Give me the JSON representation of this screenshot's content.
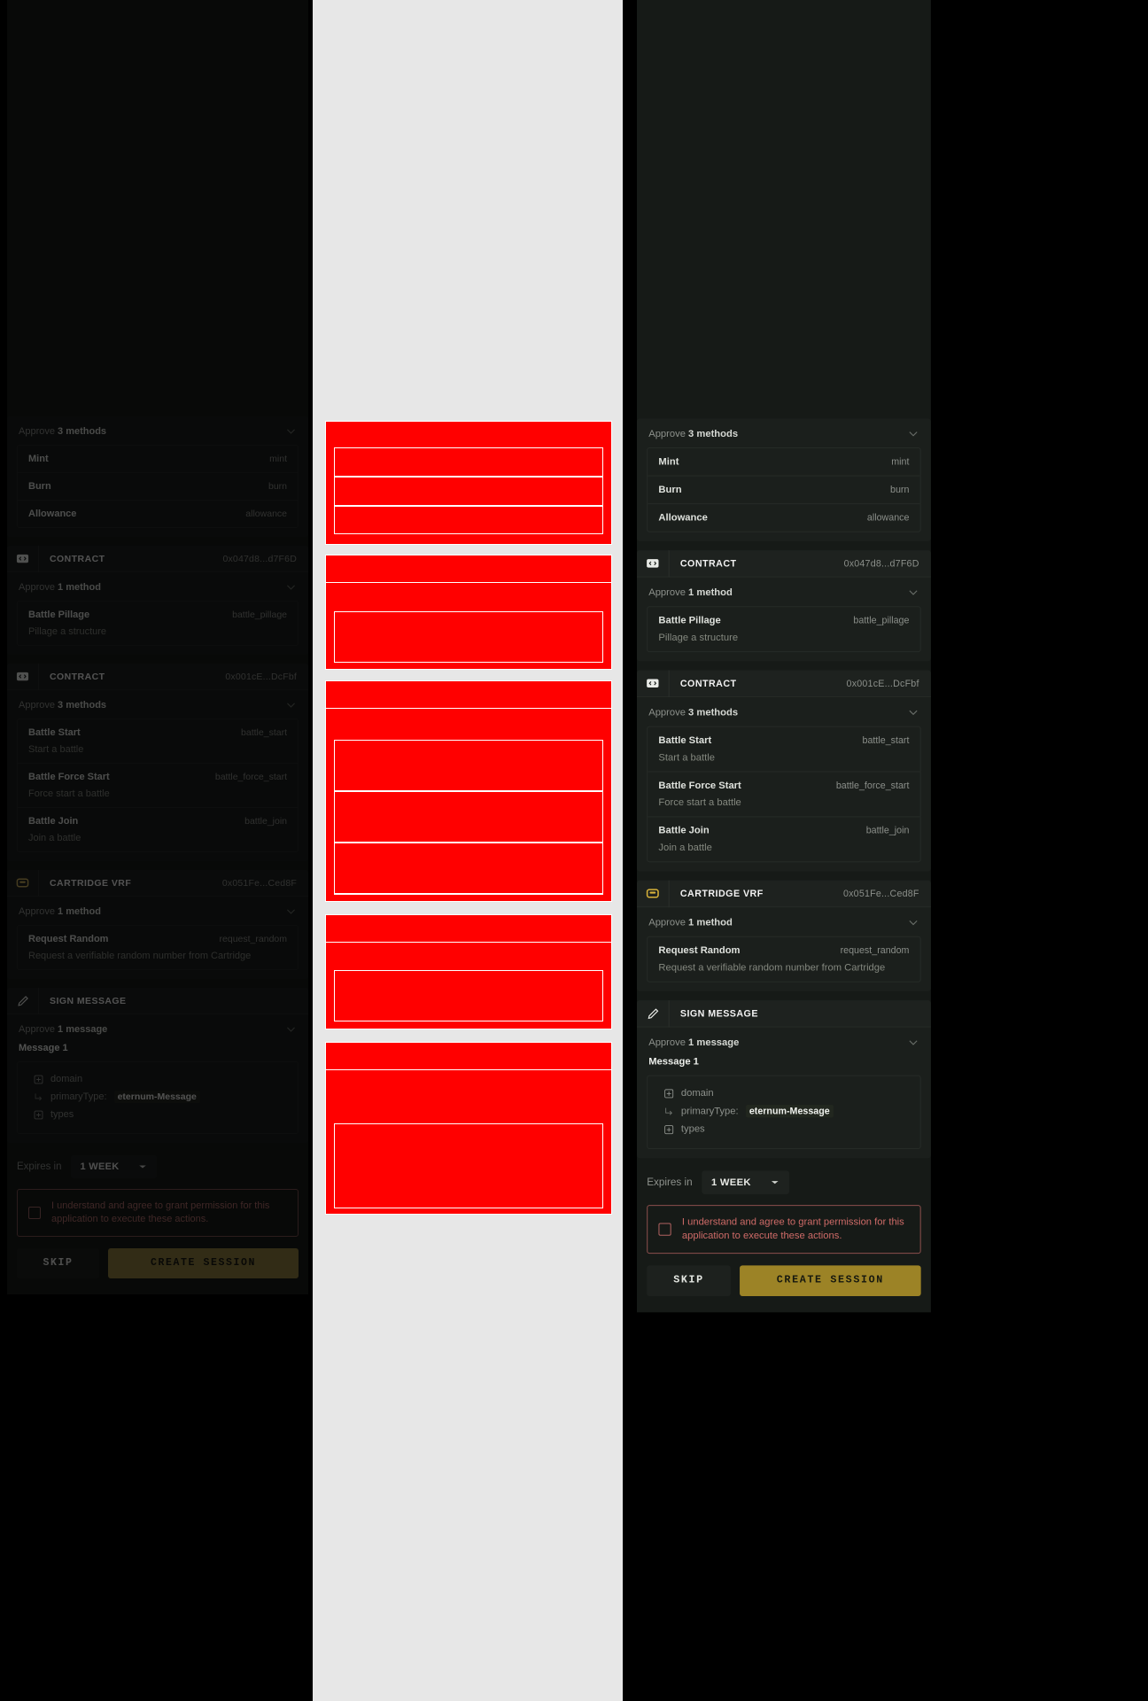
{
  "app": {
    "title": "Create Session",
    "theme_accent": "#9c8326",
    "background": "#000000",
    "panel_background": "#161a17",
    "card_background": "#1b1f1c",
    "mask_fill": "#ff0000",
    "mask_outline": "#ffffff",
    "mask_text": "#ffe000",
    "consent_color": "#cf6b68"
  },
  "panels": [
    {
      "name": "dimmed",
      "label": "dimmed-screenshot"
    },
    {
      "name": "mask",
      "label": "red-annotation-mask"
    },
    {
      "name": "light",
      "label": "normal-screenshot"
    }
  ],
  "sections": [
    {
      "id": "token-contract",
      "has_header": false,
      "header": {
        "icon": "code-icon",
        "title": "",
        "address": ""
      },
      "approve": {
        "label_prefix": "Approve ",
        "label_bold": "3 methods",
        "chevron": "chevron-down-icon"
      },
      "methods": [
        {
          "name": "Mint",
          "key": "mint",
          "desc": ""
        },
        {
          "name": "Burn",
          "key": "burn",
          "desc": ""
        },
        {
          "name": "Allowance",
          "key": "allowance",
          "desc": ""
        }
      ]
    },
    {
      "id": "contract-047d8",
      "has_header": true,
      "header": {
        "icon": "code-icon",
        "title": "CONTRACT",
        "address": "0x047d8...d7F6D"
      },
      "approve": {
        "label_prefix": "Approve ",
        "label_bold": "1 method",
        "chevron": "chevron-down-icon"
      },
      "methods": [
        {
          "name": "Battle Pillage",
          "key": "battle_pillage",
          "desc": "Pillage a structure"
        }
      ]
    },
    {
      "id": "contract-001ce",
      "has_header": true,
      "header": {
        "icon": "code-icon",
        "title": "CONTRACT",
        "address": "0x001cE...DcFbf"
      },
      "approve": {
        "label_prefix": "Approve ",
        "label_bold": "3 methods",
        "chevron": "chevron-down-icon"
      },
      "methods": [
        {
          "name": "Battle Start",
          "key": "battle_start",
          "desc": "Start a battle"
        },
        {
          "name": "Battle Force Start",
          "key": "battle_force_start",
          "desc": "Force start a battle"
        },
        {
          "name": "Battle Join",
          "key": "battle_join",
          "desc": "Join a battle"
        }
      ]
    },
    {
      "id": "cartridge-vrf",
      "has_header": true,
      "header": {
        "icon": "cartridge-icon",
        "title": "CARTRIDGE VRF",
        "address": "0x051Fe...Ced8F"
      },
      "approve": {
        "label_prefix": "Approve ",
        "label_bold": "1 method",
        "chevron": "chevron-down-icon"
      },
      "methods": [
        {
          "name": "Request Random",
          "key": "request_random",
          "desc": "Request a verifiable random number from Cartridge"
        }
      ]
    }
  ],
  "sign_message": {
    "header": {
      "icon": "pencil-icon",
      "title": "SIGN MESSAGE"
    },
    "approve": {
      "label_prefix": "Approve ",
      "label_bold": "1 message",
      "chevron": "chevron-down-icon"
    },
    "message_title": "Message 1",
    "fields": [
      {
        "icon": "plus-box-icon",
        "label": "domain",
        "value": ""
      },
      {
        "icon": "arrow-branch-icon",
        "label": "primaryType:",
        "value": "eternum-Message"
      },
      {
        "icon": "plus-box-icon",
        "label": "types",
        "value": ""
      }
    ]
  },
  "footer": {
    "expires_label": "Expires in",
    "expires_value": "1 WEEK",
    "expires_caret": "caret-down-icon",
    "consent_checkbox": "checkbox-unchecked-icon",
    "consent_text": "I understand and agree to grant permission for this application to execute these actions.",
    "skip_label": "SKIP",
    "create_label": "CREATE SESSION"
  }
}
